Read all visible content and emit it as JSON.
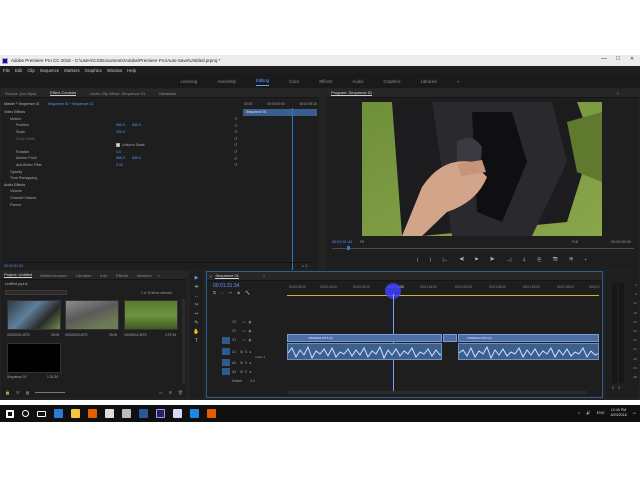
{
  "window": {
    "title": "Adobe Premiere Pro CC 2018 - C:\\Users\\CS\\Documents\\Adobe\\Premiere Pro\\Auto-Save\\Untitled.prproj *",
    "min": "—",
    "max": "☐",
    "close": "✕"
  },
  "menu": [
    "File",
    "Edit",
    "Clip",
    "Sequence",
    "Markers",
    "Graphics",
    "Window",
    "Help"
  ],
  "workspaces": {
    "items": [
      "Learning",
      "Assembly",
      "Editing",
      "Color",
      "Effects",
      "Audio",
      "Graphics",
      "Libraries"
    ],
    "active": "Editing",
    "more": "»"
  },
  "source": {
    "tabs": [
      "Source: (no clips)",
      "Effect Controls",
      "Audio Clip Mixer: Sequence 01",
      "Metadata"
    ],
    "active_tab": "Effect Controls",
    "menu": "≡",
    "header_left": "Master * Sequence 01",
    "header_right": "Sequence 01 * Sequence 01",
    "ruler": [
      "00:00",
      "00:00:00:00",
      "00:00:05:16"
    ],
    "clip_name": "Sequence 01",
    "video_effects": "Video Effects",
    "rows": [
      {
        "label": "Motion",
        "value": ""
      },
      {
        "label": "Position",
        "value": "960.0",
        "value2": "540.0"
      },
      {
        "label": "Scale",
        "value": "100.0"
      },
      {
        "label": "Scale Width",
        "value": ""
      },
      {
        "label": "",
        "check": "Uniform Scale"
      },
      {
        "label": "Rotation",
        "value": "0.0"
      },
      {
        "label": "Anchor Point",
        "value": "960.0",
        "value2": "540.0"
      },
      {
        "label": "Anti-flicker Filter",
        "value": "0.00"
      },
      {
        "label": "Opacity",
        "value": ""
      },
      {
        "label": "Time Remapping",
        "value": ""
      }
    ],
    "audio_effects": "Audio Effects",
    "audio_rows": [
      "Volume",
      "Channel Volume",
      "Panner"
    ],
    "timecode": "00:01:31:34"
  },
  "program": {
    "title": "Program: Sequence 01",
    "menu": "≡",
    "timecode": "00:01:31:34",
    "fit": "Fit",
    "quality": "Full",
    "duration": "00:00:00:00",
    "transport": [
      "{",
      "}",
      "|←",
      "◀|",
      "▶",
      "|▶",
      "→|",
      "⎀",
      "⎘",
      "📷",
      "⊞",
      "+"
    ]
  },
  "project": {
    "tabs": [
      "Project: Untitled",
      "Media Browser",
      "Libraries",
      "Info",
      "Effects",
      "Markers"
    ],
    "active_tab": "Project: Untitled",
    "more": "»",
    "file": "Untitled.prproj",
    "count": "1 of 10 items selected",
    "items": [
      {
        "name": "VID00001.MTS",
        "dur": "25:00",
        "color": "#6f8fb8"
      },
      {
        "name": "VID00023.MTS",
        "dur": "25:00",
        "color": "#8c8c8c"
      },
      {
        "name": "VID00012.MTS",
        "dur": "1:07:34",
        "color": "#5d8b3e"
      },
      {
        "name": "Sequence 01",
        "dur": "1:31:34",
        "color": "#000000"
      }
    ]
  },
  "tools": [
    "▶",
    "⇹",
    "↔",
    "✂",
    "⇿",
    "✎",
    "✋",
    "T"
  ],
  "timeline": {
    "close": "✕",
    "title": "Sequence 01",
    "menu": "≡",
    "timecode": "00:01:31:34",
    "ruler": [
      "00:00:00:00",
      "00:00:16:00",
      "00:00:32:00",
      "00:00:48:00",
      "00:01:04:00",
      "00:01:20:00",
      "00:01:36:00",
      "00:01:52:00",
      "00:02:08:00",
      "00:02:2"
    ],
    "playhead_fraction": 0.34,
    "video_tracks": [
      "V3",
      "V2",
      "V1"
    ],
    "audio_tracks": [
      "A1",
      "A2",
      "A3"
    ],
    "master": "Master",
    "master_val": "0.0",
    "audio_label": "Audio 1",
    "clips": [
      {
        "label": "VID00001.MTS [V]",
        "track": "V1",
        "start": 0.0,
        "end": 0.52
      },
      {
        "label": "VID00023.MTS [V]",
        "track": "V1",
        "start": 0.52,
        "end": 0.55
      },
      {
        "label": "VID00012.MTS [V]",
        "track": "V1",
        "start": 0.55,
        "end": 1.0
      }
    ],
    "meter_labels": [
      "0",
      "-6",
      "-12",
      "-18",
      "-24",
      "-30",
      "-36",
      "-42",
      "-48",
      "-54",
      "dB"
    ],
    "meter_solo": [
      "S",
      "S"
    ]
  },
  "taskbar": {
    "time": "12:40 PM",
    "date": "8/20/2018",
    "lang": "ENG",
    "icons": [
      {
        "name": "start",
        "color": "#ffffff"
      },
      {
        "name": "search",
        "color": "#ffffff"
      },
      {
        "name": "taskview",
        "color": "#ffffff"
      },
      {
        "name": "edge",
        "color": "#2c7bd8"
      },
      {
        "name": "explorer",
        "color": "#f6c440"
      },
      {
        "name": "firefox",
        "color": "#e66000"
      },
      {
        "name": "chrome",
        "color": "#dddddd"
      },
      {
        "name": "davinci",
        "color": "#bbbbbb"
      },
      {
        "name": "word",
        "color": "#2b579a"
      },
      {
        "name": "premiere",
        "color": "#2b1f5c"
      },
      {
        "name": "paint",
        "color": "#d8d8ff"
      },
      {
        "name": "store",
        "color": "#1e88e5"
      },
      {
        "name": "search-app",
        "color": "#e65c00"
      }
    ]
  }
}
